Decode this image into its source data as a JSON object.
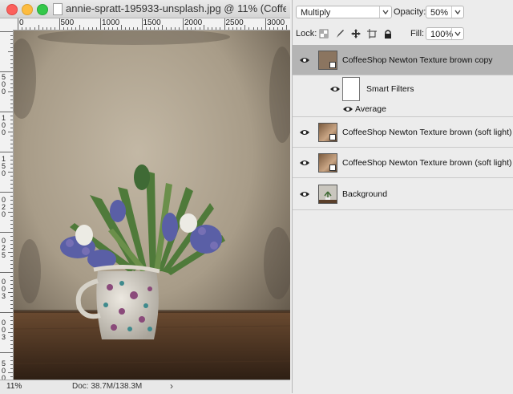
{
  "document": {
    "title": "annie-spratt-195933-unsplash.jpg @ 11% (Coffe...",
    "ruler_numbers": [
      "0",
      "500",
      "1000",
      "1500",
      "2000",
      "2500",
      "3000"
    ],
    "vruler_numbers": [
      "5",
      "0",
      "0",
      "1",
      "0",
      "0",
      "1",
      "5",
      "0",
      "0",
      "2",
      "0",
      "0",
      "2",
      "5",
      "0",
      "0",
      "3",
      "0",
      "0",
      "3",
      "5",
      "0",
      "0"
    ],
    "zoom": "11%",
    "doc_info": "Doc: 38.7M/138.3M",
    "status_arrow": "›"
  },
  "layers_panel": {
    "blend_mode": "Multiply",
    "opacity_label": "Opacity:",
    "opacity_value": "50%",
    "lock_label": "Lock:",
    "fill_label": "Fill:",
    "fill_value": "100%",
    "layers": [
      {
        "name": "CoffeeShop Newton Texture brown copy",
        "selected": true,
        "thumb": "texture-brown",
        "smart": true
      },
      {
        "name": "Smart Filters",
        "type": "smart-filters"
      },
      {
        "name": "Average",
        "type": "filter"
      },
      {
        "name": "CoffeeShop Newton Texture brown (soft light)",
        "thumb": "texture",
        "smart": true
      },
      {
        "name": "CoffeeShop Newton Texture brown (soft light)",
        "thumb": "texture",
        "smart": true
      },
      {
        "name": "Background",
        "thumb": "photo"
      }
    ]
  },
  "colors": {
    "selected_row": "#b4b4b4",
    "texture_brown": "#8b7560"
  }
}
